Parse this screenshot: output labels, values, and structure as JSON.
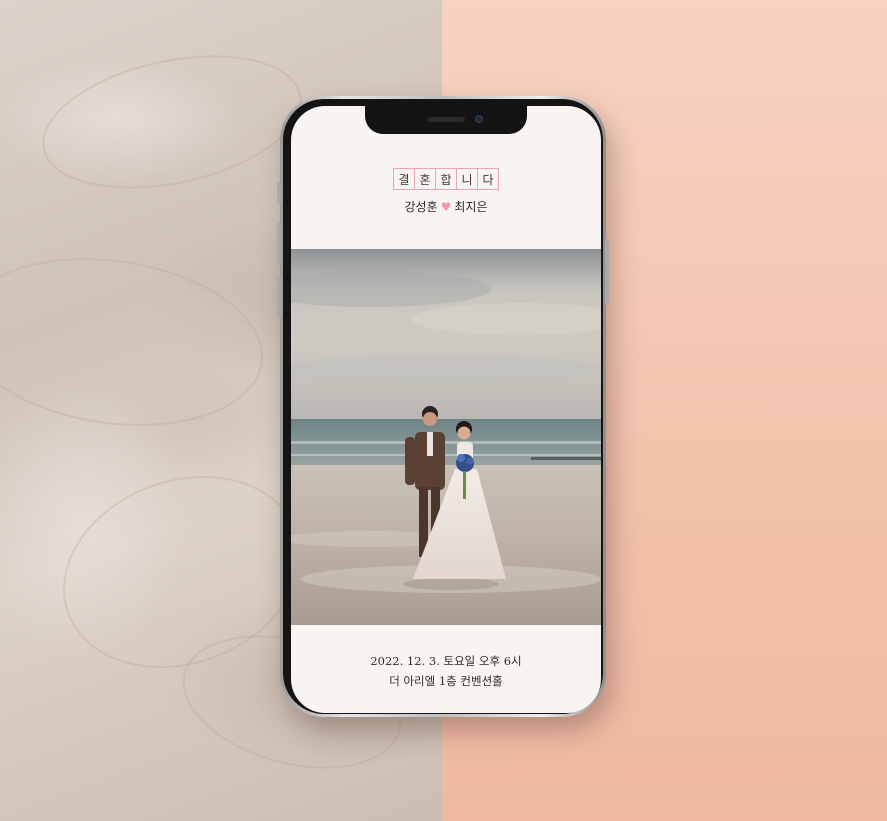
{
  "invitation": {
    "title_chars": [
      "결",
      "혼",
      "합",
      "니",
      "다"
    ],
    "groom_name": "강성훈",
    "bride_name": "최지은",
    "separator_icon": "heart-icon",
    "date_time": "2022. 12. 3. 토요일 오후 6시",
    "venue": "더 아리엘 1층 컨벤션홀"
  },
  "colors": {
    "accent_pink": "#e8a7ad",
    "heart": "#f09aa4",
    "screen_bg": "#f7f4f1",
    "backdrop_peach": "#f3c3ad",
    "backdrop_marble": "#d6cbc1"
  }
}
